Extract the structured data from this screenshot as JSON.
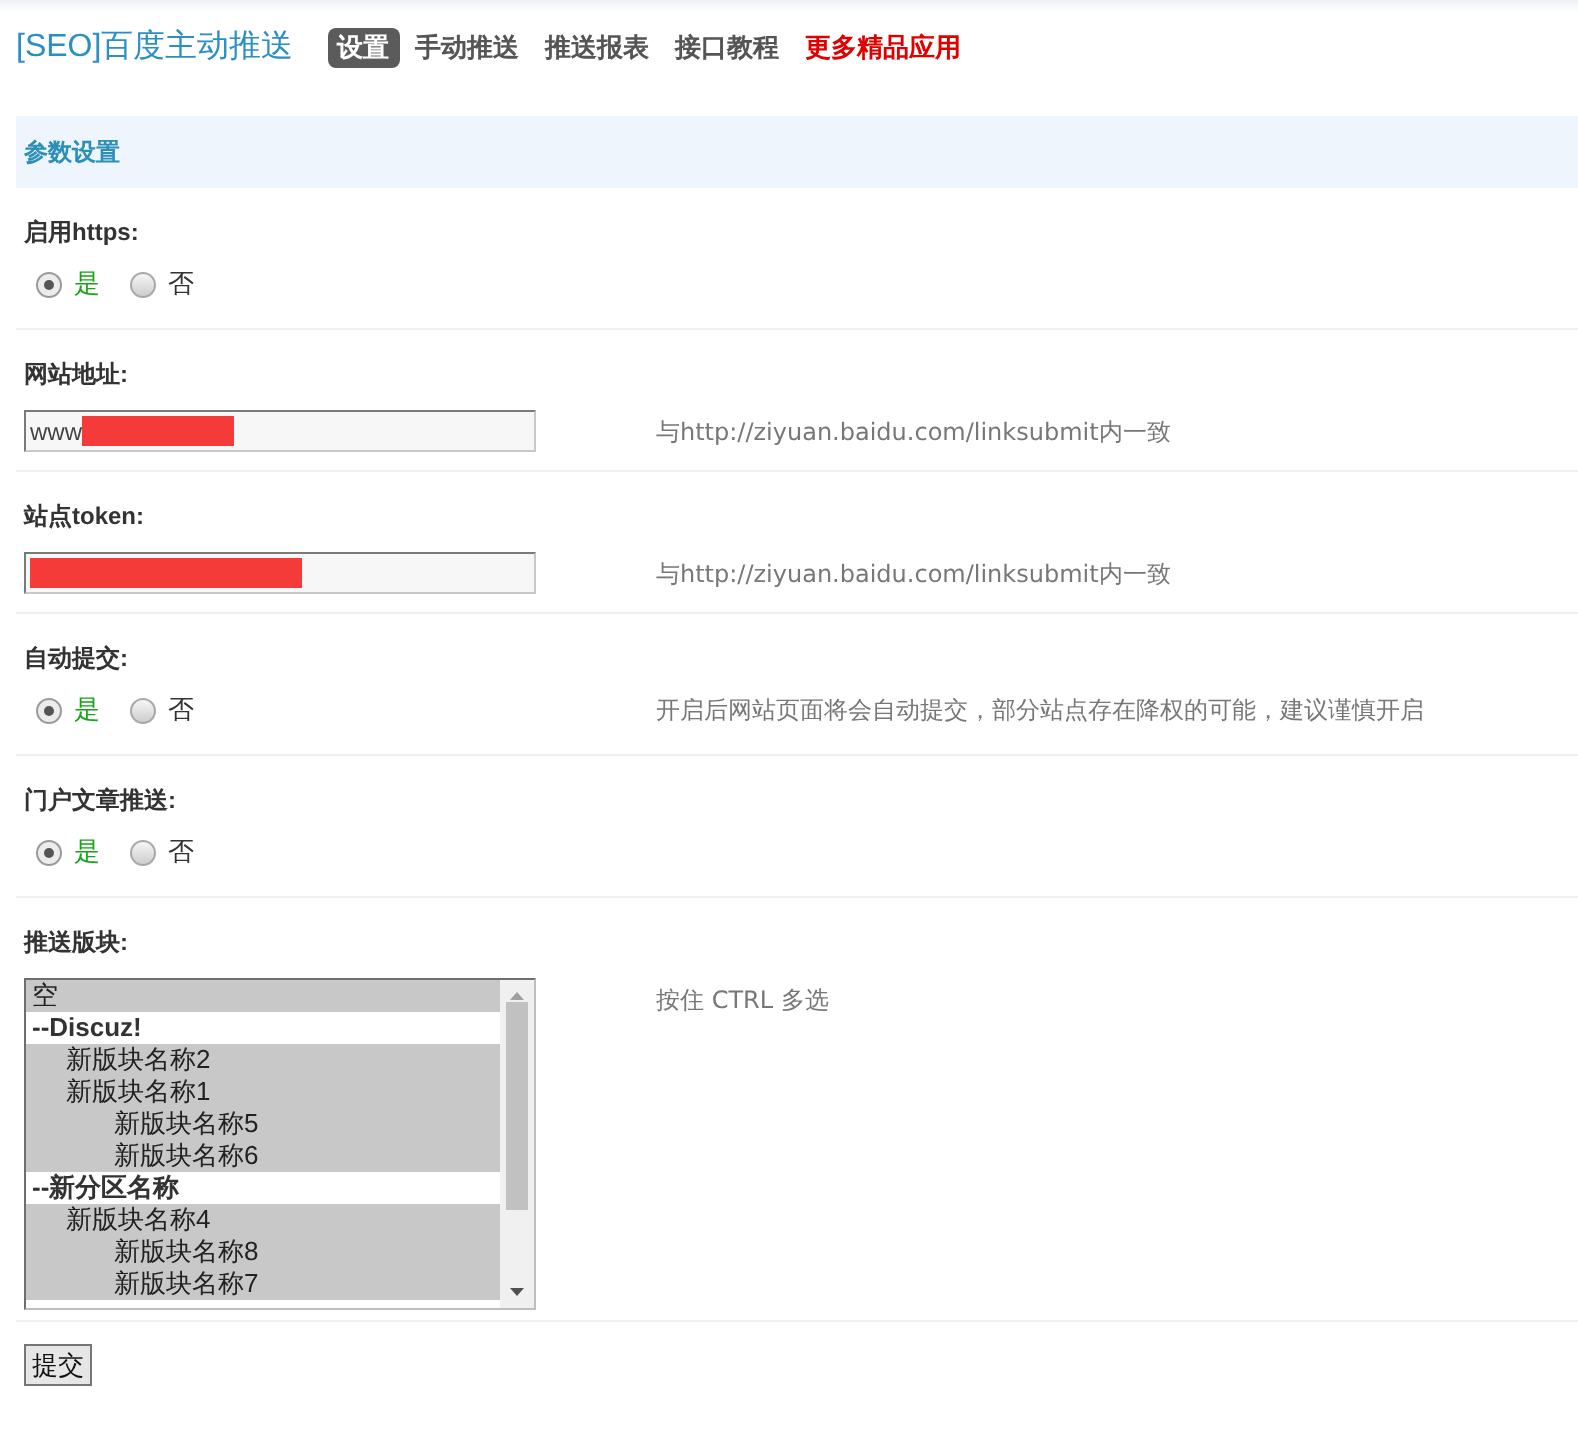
{
  "header": {
    "title": "[SEO]百度主动推送",
    "tabs": [
      {
        "label": "设置",
        "selected": true,
        "kind": "tab"
      },
      {
        "label": "手动推送",
        "selected": false,
        "kind": "tab"
      },
      {
        "label": "推送报表",
        "selected": false,
        "kind": "tab"
      },
      {
        "label": "接口教程",
        "selected": false,
        "kind": "tab"
      },
      {
        "label": "更多精品应用",
        "selected": false,
        "kind": "promo"
      }
    ]
  },
  "section": {
    "title": "参数设置"
  },
  "settings": [
    {
      "kind": "radio",
      "label": "启用https:",
      "options": [
        {
          "label": "是",
          "selected": true,
          "color": "#1aa31a"
        },
        {
          "label": "否",
          "selected": false,
          "color": "#333333"
        }
      ]
    },
    {
      "kind": "text",
      "label": "网站地址:",
      "value": "www",
      "redacted": true,
      "hint": "与http://ziyuan.baidu.com/linksubmit内一致"
    },
    {
      "kind": "text",
      "label": "站点token:",
      "redacted": true,
      "hint": "与http://ziyuan.baidu.com/linksubmit内一致"
    },
    {
      "kind": "radio",
      "label": "自动提交:",
      "options": [
        {
          "label": "是",
          "selected": true,
          "color": "#1aa31a"
        },
        {
          "label": "否",
          "selected": false,
          "color": "#333333"
        }
      ],
      "hint": "开启后网站页面将会自动提交，部分站点存在降权的可能，建议谨慎开启"
    },
    {
      "kind": "radio",
      "label": "门户文章推送:",
      "options": [
        {
          "label": "是",
          "selected": true,
          "color": "#1aa31a"
        },
        {
          "label": "否",
          "selected": false,
          "color": "#333333"
        }
      ]
    },
    {
      "kind": "multiselect",
      "label": "推送版块:",
      "hint": "按住 CTRL 多选",
      "options": [
        {
          "kind": "option",
          "label": "空",
          "selected": true
        },
        {
          "kind": "group",
          "label": "--Discuz!",
          "selected": false,
          "children": [
            {
              "label": "新版块名称2",
              "selected": true
            },
            {
              "label": "新版块名称1",
              "selected": true,
              "children": [
                {
                  "label": "新版块名称5",
                  "selected": true
                },
                {
                  "label": "新版块名称6",
                  "selected": true
                }
              ]
            }
          ]
        },
        {
          "kind": "group",
          "label": "--新分区名称",
          "selected": false,
          "children": [
            {
              "label": "新版块名称4",
              "selected": true,
              "children": [
                {
                  "label": "新版块名称8",
                  "selected": true
                },
                {
                  "label": "新版块名称7",
                  "selected": true
                }
              ]
            }
          ]
        }
      ]
    }
  ],
  "submit_button": "提交"
}
